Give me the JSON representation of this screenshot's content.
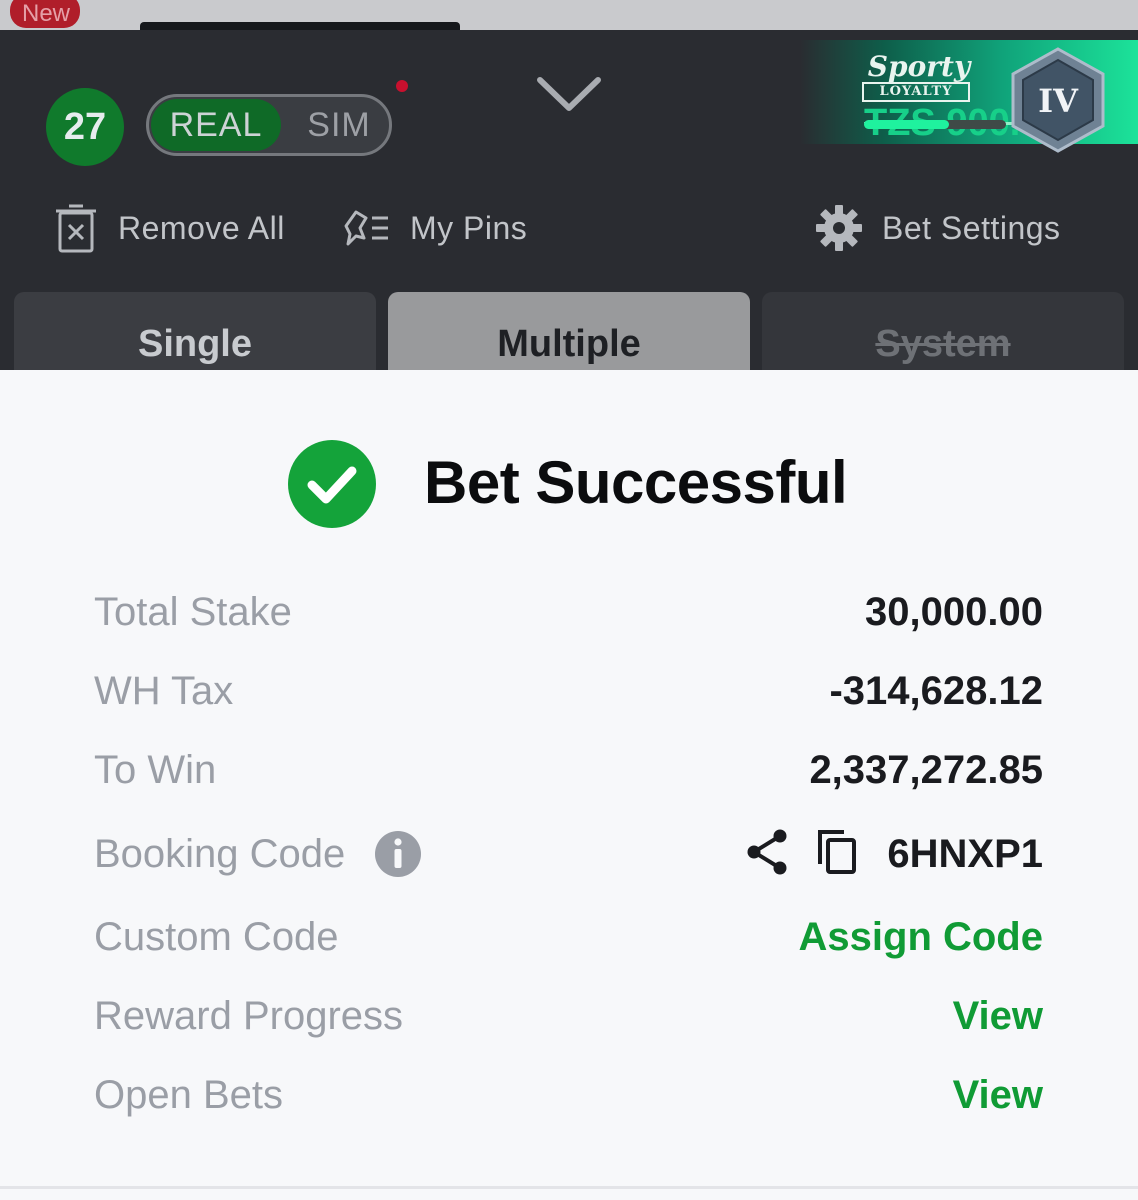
{
  "top_strip": {
    "new_badge": "New"
  },
  "header": {
    "bet_count": "27",
    "mode_toggle": {
      "real_label": "REAL",
      "sim_label": "SIM",
      "selected": "REAL"
    },
    "loyalty": {
      "logo_line1": "Sporty",
      "logo_line2": "LOYALTY",
      "balance": "TZS 900.67",
      "progress": 0.6,
      "tier": "IV"
    },
    "toolbar": {
      "remove_all": "Remove All",
      "my_pins": "My Pins",
      "bet_settings": "Bet Settings"
    },
    "tabs": [
      {
        "label": "Single"
      },
      {
        "label": "Multiple",
        "selected": true
      },
      {
        "label": "System",
        "disabled": true
      }
    ]
  },
  "result": {
    "title": "Bet Successful",
    "rows": [
      {
        "label": "Total Stake",
        "value": "30,000.00"
      },
      {
        "label": "WH Tax",
        "value": "-314,628.12"
      },
      {
        "label": "To Win",
        "value": "2,337,272.85"
      },
      {
        "label": "Booking Code",
        "value": "6HNXP1"
      },
      {
        "label": "Custom Code",
        "value": "Assign Code"
      },
      {
        "label": "Reward Progress",
        "value": "View"
      },
      {
        "label": "Open Bets",
        "value": "View"
      }
    ]
  },
  "colors": {
    "header_bg": "#2a2c31",
    "accent_green": "#109b35",
    "success_green": "#14a33a",
    "label_gray": "#9a9ea6"
  },
  "icons": [
    "trash-icon",
    "pin-list-icon",
    "gear-icon",
    "chevron-down-icon",
    "check-circle-icon",
    "info-icon",
    "share-icon",
    "copy-icon",
    "tier-badge-icon"
  ]
}
